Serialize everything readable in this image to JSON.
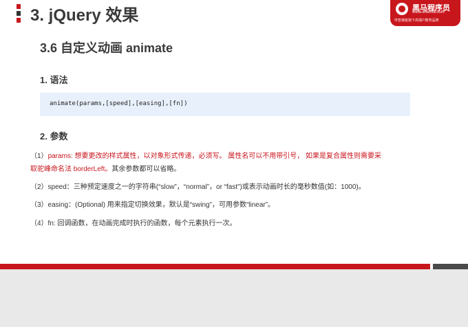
{
  "title": "3. jQuery 效果",
  "logo": {
    "name": "黑马程序员",
    "url": "www.itheima.com",
    "slogan": "传智播客旗下高端IT教育品牌"
  },
  "section": "3.6  自定义动画 animate",
  "syntax": {
    "heading": "1. 语法",
    "code": "animate(params,[speed],[easing],[fn])"
  },
  "params": {
    "heading": "2. 参数",
    "items": [
      {
        "prefix": "（1）",
        "red_text": "params: 想要更改的样式属性，以对象形式传递，必须写。 属性名可以不用带引号， 如果是复合属性则需要采",
        "red_text_2": "取驼峰命名法 borderLeft。",
        "text": "其余参数都可以省略。"
      },
      {
        "text": "（2）speed：三种预定速度之一的字符串(“slow”，“normal”，or “fast”)或表示动画时长的毫秒数值(如：1000)。"
      },
      {
        "text": "（3）easing：(Optional) 用来指定切换效果，默认是“swing”，可用参数“linear”。"
      },
      {
        "text": "（4）fn:  回调函数，在动画完成时执行的函数，每个元素执行一次。"
      }
    ]
  }
}
